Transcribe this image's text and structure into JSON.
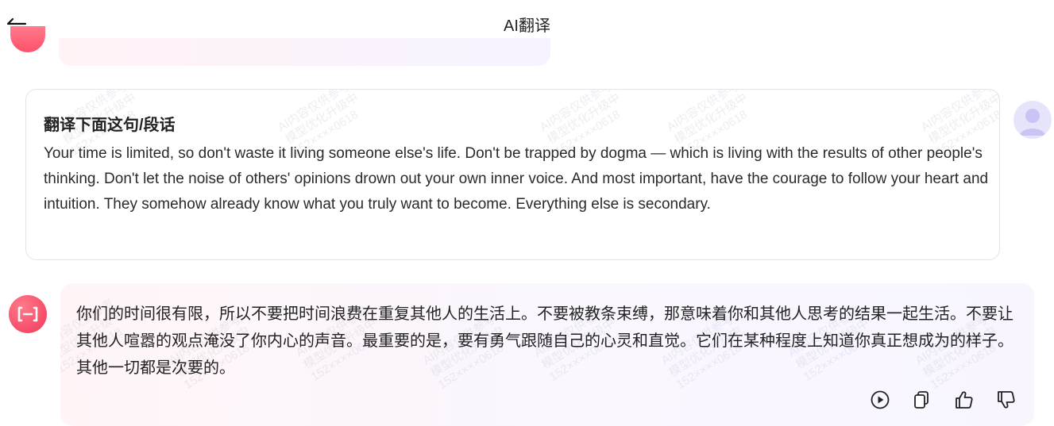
{
  "header": {
    "title": "AI翻译",
    "back_icon": "back-arrow-icon"
  },
  "user_message": {
    "heading": "翻译下面这句/段话",
    "text": "Your time is limited, so don't waste it living someone else's life. Don't be trapped by dogma — which is living with the results of other people's thinking. Don't let the noise of others' opinions drown out your own inner voice. And most important, have the courage to follow your heart and intuition. They somehow already know what you truly want to become. Everything else is secondary.",
    "avatar_icon": "user-avatar-icon"
  },
  "ai_message": {
    "text": "你们的时间很有限，所以不要把时间浪费在重复其他人的生活上。不要被教条束缚，那意味着你和其他人思考的结果一起生活。不要让其他人喧嚣的观点淹没了你内心的声音。最重要的是，要有勇气跟随自己的心灵和直觉。它们在某种程度上知道你真正想成为的样子。其他一切都是次要的。",
    "avatar_icon": "ai-logo-icon",
    "actions": [
      {
        "name": "play-icon"
      },
      {
        "name": "copy-icon"
      },
      {
        "name": "thumbs-up-icon"
      },
      {
        "name": "thumbs-down-icon"
      }
    ]
  },
  "watermark": {
    "line1": "AI内容仅供参考",
    "line2": "模型优化升级中",
    "line3": "152××××0618"
  },
  "colors": {
    "accent": "#f2385a",
    "user_avatar_bg": "#e6e4fb",
    "card_border": "#e3e3ea"
  }
}
